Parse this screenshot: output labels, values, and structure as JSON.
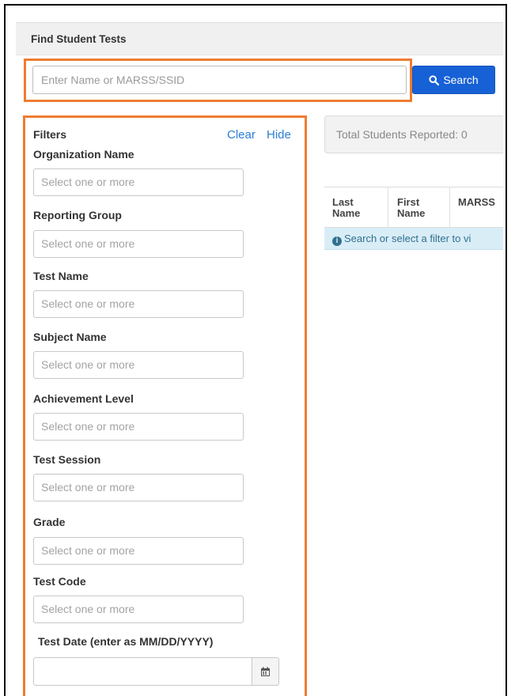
{
  "header": {
    "title": "Find Student Tests"
  },
  "search": {
    "placeholder": "Enter Name or MARSS/SSID",
    "value": "",
    "button_label": "Search",
    "button_icon": "search-icon"
  },
  "filters": {
    "title": "Filters",
    "clear_label": "Clear",
    "hide_label": "Hide",
    "items": [
      {
        "label": "Organization Name",
        "placeholder": "Select one or more"
      },
      {
        "label": "Reporting Group",
        "placeholder": "Select one or more"
      },
      {
        "label": "Test Name",
        "placeholder": "Select one or more"
      },
      {
        "label": "Subject Name",
        "placeholder": "Select one or more"
      },
      {
        "label": "Achievement Level",
        "placeholder": "Select one or more"
      },
      {
        "label": "Test Session",
        "placeholder": "Select one or more"
      },
      {
        "label": "Grade",
        "placeholder": "Select one or more"
      },
      {
        "label": "Test Code",
        "placeholder": "Select one or more"
      }
    ],
    "date": {
      "label": "Test Date (enter as MM/DD/YYYY)",
      "value": "",
      "icon": "calendar-icon"
    }
  },
  "results": {
    "total_label": "Total Students Reported: 0",
    "columns": [
      {
        "line1": "Last",
        "line2": "Name"
      },
      {
        "line1": "First",
        "line2": "Name"
      },
      {
        "line1": "",
        "line2": "MARSS"
      }
    ],
    "info_message": "Search or select a filter to vi"
  },
  "colors": {
    "highlight": "#ed7d31",
    "primary_button": "#1761d6",
    "link": "#2a7fd4",
    "info_background": "#d9edf7"
  }
}
